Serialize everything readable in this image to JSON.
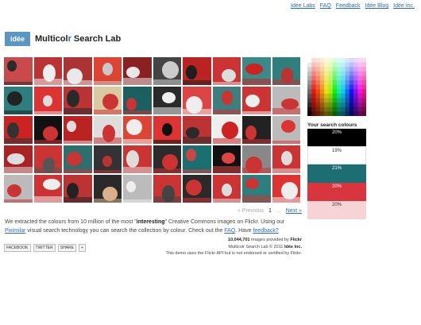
{
  "nav": {
    "links": [
      "Idée Labs",
      "FAQ",
      "Feedback",
      "Idée Blog",
      "Idée Inc."
    ]
  },
  "brand": {
    "logo": "idée",
    "title_a": "Multicol",
    "title_b": "r",
    "title_c": " Search Lab"
  },
  "grid": {
    "tiles": [
      [
        "#c94a4a",
        "#2b2b2b"
      ],
      [
        "#b33",
        "#eee"
      ],
      [
        "#a33",
        "#e9e9e9"
      ],
      [
        "#d43",
        "#c8c8c8"
      ],
      [
        "#8a2020",
        "#e8e8e8"
      ],
      [
        "#444",
        "#ccc"
      ],
      [
        "#b22",
        "#1f1f1f"
      ],
      [
        "#c33",
        "#ddd"
      ],
      [
        "#3a8a8a",
        "#c22"
      ],
      [
        "#2f7f7f",
        "#b33"
      ],
      [
        "#2d7f7f",
        "#222"
      ],
      [
        "#d33",
        "#ddd"
      ],
      [
        "#b33",
        "#2a2a2a"
      ],
      [
        "#d9c9a0",
        "#c33"
      ],
      [
        "#1a6060",
        "#c33"
      ],
      [
        "#2a2a2a",
        "#eee"
      ],
      [
        "#d44",
        "#eee"
      ],
      [
        "#3d7f7f",
        "#c33"
      ],
      [
        "#c33",
        "#eee"
      ],
      [
        "#bbb",
        "#c33"
      ],
      [
        "#c22",
        "#333"
      ],
      [
        "#111",
        "#c33"
      ],
      [
        "#b22",
        "#ddd"
      ],
      [
        "#ddd",
        "#c33"
      ],
      [
        "#d43",
        "#eee"
      ],
      [
        "#d33",
        "#111"
      ],
      [
        "#b33",
        "#2a2a2a"
      ],
      [
        "#eee",
        "#c22"
      ],
      [
        "#222",
        "#c33"
      ],
      [
        "#bbb",
        "#d33"
      ],
      [
        "#a22",
        "#ddd"
      ],
      [
        "#c33",
        "#555"
      ],
      [
        "#2d6f6f",
        "#c33"
      ],
      [
        "#333",
        "#b33"
      ],
      [
        "#c33",
        "#ddd"
      ],
      [
        "#2b2b2b",
        "#c33"
      ],
      [
        "#1a7070",
        "#c44"
      ],
      [
        "#111",
        "#d44"
      ],
      [
        "#888",
        "#c33"
      ],
      [
        "#c33",
        "#ddd"
      ],
      [
        "#bbb",
        "#c33"
      ],
      [
        "#c33",
        "#eee"
      ],
      [
        "#b33",
        "#222"
      ],
      [
        "#2a2a2a",
        "#d9b08a"
      ],
      [
        "#bbb",
        "#eee"
      ],
      [
        "#c33",
        "#444"
      ],
      [
        "#2a2a2a",
        "#c33"
      ],
      [
        "#c33",
        "#ddd"
      ],
      [
        "#2d7f7f",
        "#c33"
      ],
      [
        "#d33",
        "#eee"
      ]
    ]
  },
  "pager": {
    "previous": "« Previous",
    "current": "1",
    "ellipsis": "...",
    "next": "Next »"
  },
  "intro": {
    "a": "We extracted the colours from 10 million of the most \"",
    "interesting": "interesting",
    "b": "\" Creative Commons images on Flickr. Using our ",
    "piximilar": "Piximilar",
    "c": " visual search technology you can search the collection by colour. Check out the ",
    "faq": "FAQ",
    "d": ". Have ",
    "feedback": "feedback?"
  },
  "stats": {
    "count": "10,044,701",
    "count_suffix": " images provided by ",
    "flickr": "Flickr",
    "copy_a": "Multicolr Search Lab © 2011 ",
    "idee": "Idée Inc.",
    "disclaimer": "This demo uses the Flickr API but is not endorsed or certified by Flickr."
  },
  "share": [
    "FACEBOOK",
    "TWITTER",
    "SHARE",
    "+"
  ],
  "colours": {
    "title": "Your search colours",
    "swatches": [
      {
        "color": "#000000",
        "label": "20%",
        "text": "#ffffff"
      },
      {
        "color": "#ffffff",
        "label": "19%",
        "text": "#333333"
      },
      {
        "color": "#1c6e73",
        "label": "21%",
        "text": "#ffffff"
      },
      {
        "color": "#d9353f",
        "label": "20%",
        "text": "#ffffff"
      },
      {
        "color": "#f6d4d6",
        "label": "20%",
        "text": "#333333"
      }
    ]
  }
}
